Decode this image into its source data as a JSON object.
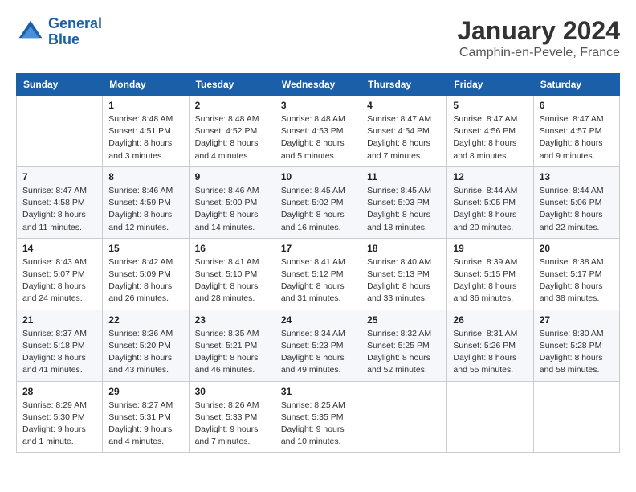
{
  "header": {
    "logo_line1": "General",
    "logo_line2": "Blue",
    "title": "January 2024",
    "subtitle": "Camphin-en-Pevele, France"
  },
  "calendar": {
    "days_of_week": [
      "Sunday",
      "Monday",
      "Tuesday",
      "Wednesday",
      "Thursday",
      "Friday",
      "Saturday"
    ],
    "weeks": [
      [
        {
          "day": "",
          "detail": ""
        },
        {
          "day": "1",
          "detail": "Sunrise: 8:48 AM\nSunset: 4:51 PM\nDaylight: 8 hours\nand 3 minutes."
        },
        {
          "day": "2",
          "detail": "Sunrise: 8:48 AM\nSunset: 4:52 PM\nDaylight: 8 hours\nand 4 minutes."
        },
        {
          "day": "3",
          "detail": "Sunrise: 8:48 AM\nSunset: 4:53 PM\nDaylight: 8 hours\nand 5 minutes."
        },
        {
          "day": "4",
          "detail": "Sunrise: 8:47 AM\nSunset: 4:54 PM\nDaylight: 8 hours\nand 7 minutes."
        },
        {
          "day": "5",
          "detail": "Sunrise: 8:47 AM\nSunset: 4:56 PM\nDaylight: 8 hours\nand 8 minutes."
        },
        {
          "day": "6",
          "detail": "Sunrise: 8:47 AM\nSunset: 4:57 PM\nDaylight: 8 hours\nand 9 minutes."
        }
      ],
      [
        {
          "day": "7",
          "detail": "Sunrise: 8:47 AM\nSunset: 4:58 PM\nDaylight: 8 hours\nand 11 minutes."
        },
        {
          "day": "8",
          "detail": "Sunrise: 8:46 AM\nSunset: 4:59 PM\nDaylight: 8 hours\nand 12 minutes."
        },
        {
          "day": "9",
          "detail": "Sunrise: 8:46 AM\nSunset: 5:00 PM\nDaylight: 8 hours\nand 14 minutes."
        },
        {
          "day": "10",
          "detail": "Sunrise: 8:45 AM\nSunset: 5:02 PM\nDaylight: 8 hours\nand 16 minutes."
        },
        {
          "day": "11",
          "detail": "Sunrise: 8:45 AM\nSunset: 5:03 PM\nDaylight: 8 hours\nand 18 minutes."
        },
        {
          "day": "12",
          "detail": "Sunrise: 8:44 AM\nSunset: 5:05 PM\nDaylight: 8 hours\nand 20 minutes."
        },
        {
          "day": "13",
          "detail": "Sunrise: 8:44 AM\nSunset: 5:06 PM\nDaylight: 8 hours\nand 22 minutes."
        }
      ],
      [
        {
          "day": "14",
          "detail": "Sunrise: 8:43 AM\nSunset: 5:07 PM\nDaylight: 8 hours\nand 24 minutes."
        },
        {
          "day": "15",
          "detail": "Sunrise: 8:42 AM\nSunset: 5:09 PM\nDaylight: 8 hours\nand 26 minutes."
        },
        {
          "day": "16",
          "detail": "Sunrise: 8:41 AM\nSunset: 5:10 PM\nDaylight: 8 hours\nand 28 minutes."
        },
        {
          "day": "17",
          "detail": "Sunrise: 8:41 AM\nSunset: 5:12 PM\nDaylight: 8 hours\nand 31 minutes."
        },
        {
          "day": "18",
          "detail": "Sunrise: 8:40 AM\nSunset: 5:13 PM\nDaylight: 8 hours\nand 33 minutes."
        },
        {
          "day": "19",
          "detail": "Sunrise: 8:39 AM\nSunset: 5:15 PM\nDaylight: 8 hours\nand 36 minutes."
        },
        {
          "day": "20",
          "detail": "Sunrise: 8:38 AM\nSunset: 5:17 PM\nDaylight: 8 hours\nand 38 minutes."
        }
      ],
      [
        {
          "day": "21",
          "detail": "Sunrise: 8:37 AM\nSunset: 5:18 PM\nDaylight: 8 hours\nand 41 minutes."
        },
        {
          "day": "22",
          "detail": "Sunrise: 8:36 AM\nSunset: 5:20 PM\nDaylight: 8 hours\nand 43 minutes."
        },
        {
          "day": "23",
          "detail": "Sunrise: 8:35 AM\nSunset: 5:21 PM\nDaylight: 8 hours\nand 46 minutes."
        },
        {
          "day": "24",
          "detail": "Sunrise: 8:34 AM\nSunset: 5:23 PM\nDaylight: 8 hours\nand 49 minutes."
        },
        {
          "day": "25",
          "detail": "Sunrise: 8:32 AM\nSunset: 5:25 PM\nDaylight: 8 hours\nand 52 minutes."
        },
        {
          "day": "26",
          "detail": "Sunrise: 8:31 AM\nSunset: 5:26 PM\nDaylight: 8 hours\nand 55 minutes."
        },
        {
          "day": "27",
          "detail": "Sunrise: 8:30 AM\nSunset: 5:28 PM\nDaylight: 8 hours\nand 58 minutes."
        }
      ],
      [
        {
          "day": "28",
          "detail": "Sunrise: 8:29 AM\nSunset: 5:30 PM\nDaylight: 9 hours\nand 1 minute."
        },
        {
          "day": "29",
          "detail": "Sunrise: 8:27 AM\nSunset: 5:31 PM\nDaylight: 9 hours\nand 4 minutes."
        },
        {
          "day": "30",
          "detail": "Sunrise: 8:26 AM\nSunset: 5:33 PM\nDaylight: 9 hours\nand 7 minutes."
        },
        {
          "day": "31",
          "detail": "Sunrise: 8:25 AM\nSunset: 5:35 PM\nDaylight: 9 hours\nand 10 minutes."
        },
        {
          "day": "",
          "detail": ""
        },
        {
          "day": "",
          "detail": ""
        },
        {
          "day": "",
          "detail": ""
        }
      ]
    ]
  }
}
